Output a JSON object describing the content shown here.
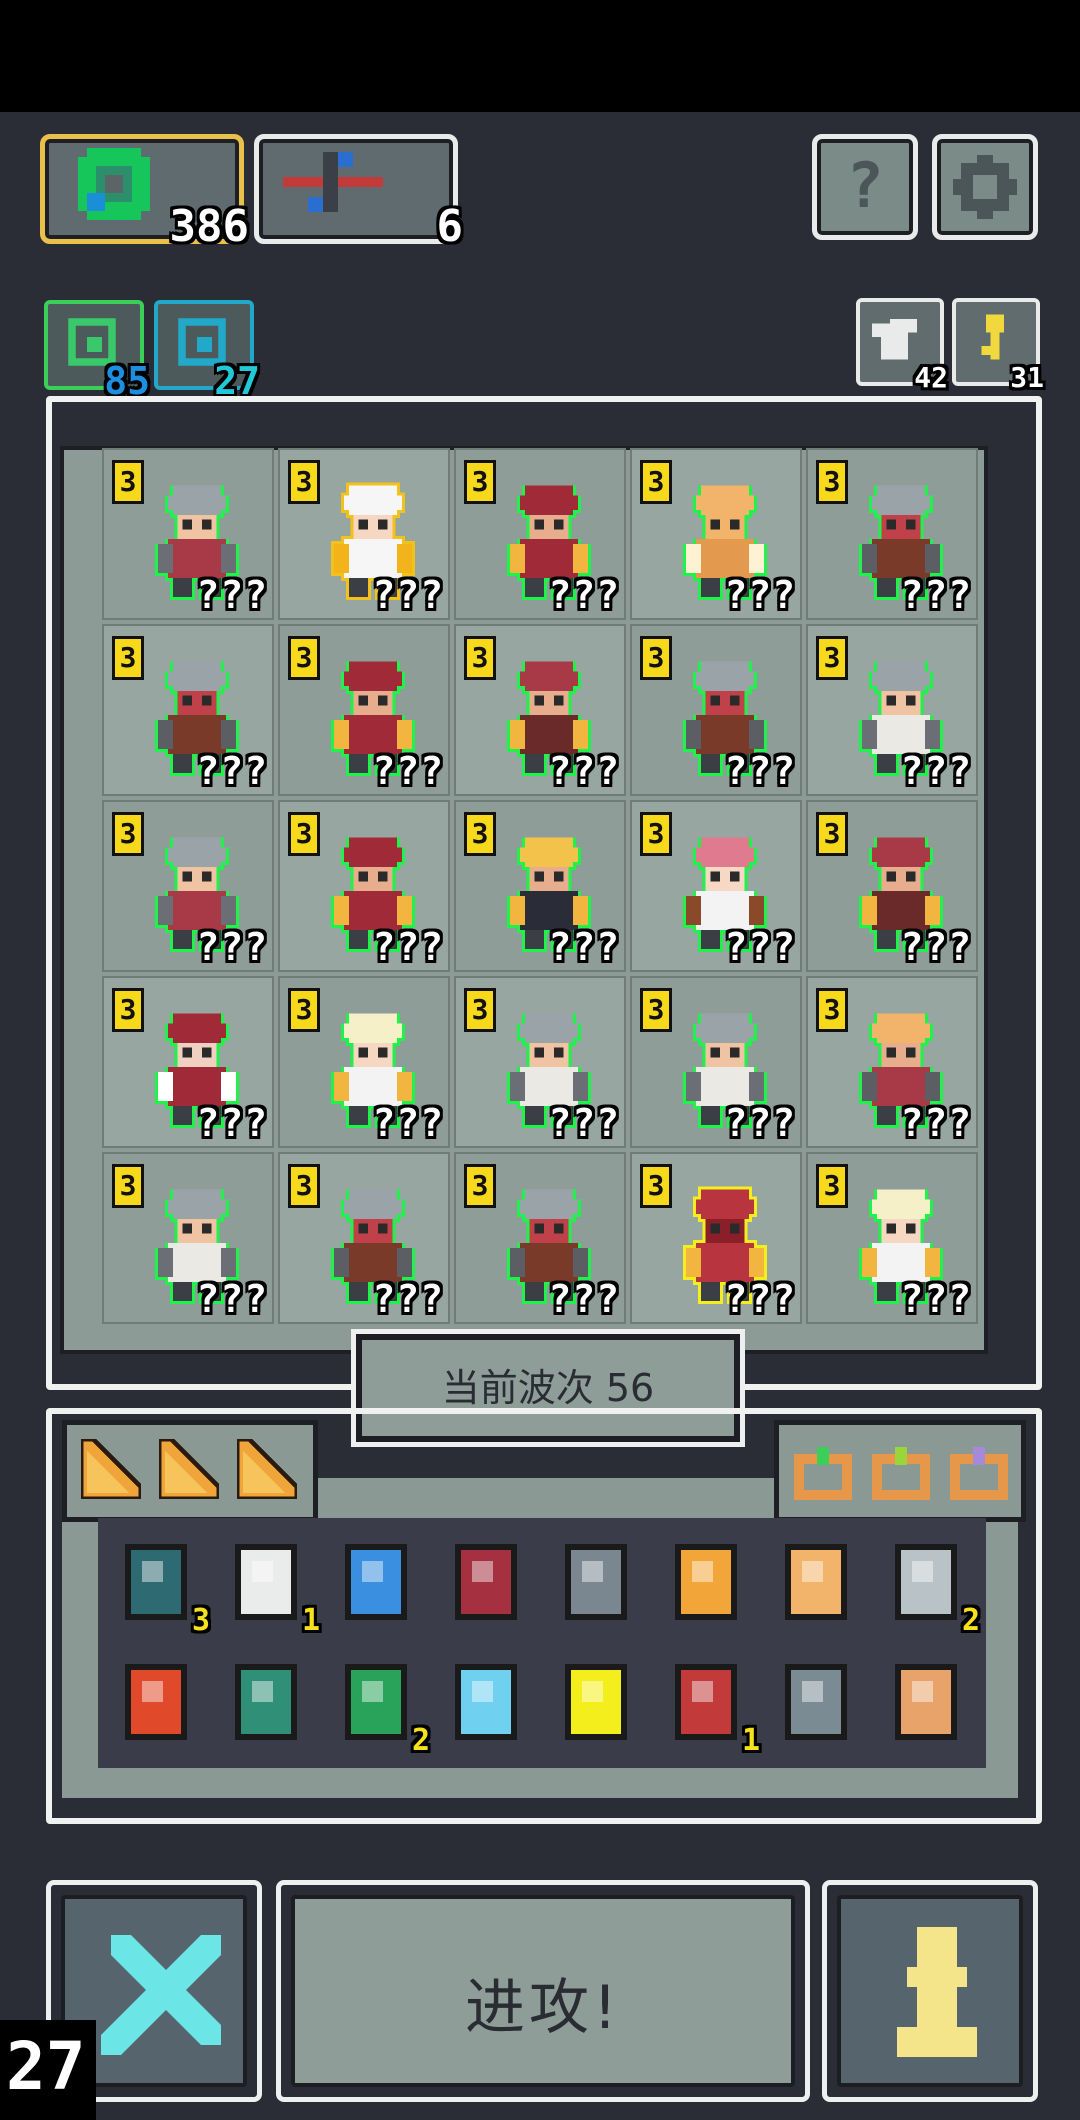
{
  "resources": {
    "main": [
      {
        "icon": "green-gem-icon",
        "value": "386",
        "active": true
      },
      {
        "icon": "crossbow-icon",
        "value": "6",
        "active": false
      }
    ],
    "small": [
      {
        "icon": "green-spiral-icon",
        "value": "85",
        "color": "#1d8fe0"
      },
      {
        "icon": "blue-spiral-icon",
        "value": "27",
        "color": "#22c8d8"
      }
    ],
    "right_small": [
      {
        "icon": "return-arrow-icon",
        "value": "42"
      },
      {
        "icon": "key-icon",
        "value": "31"
      }
    ],
    "help_label": "?",
    "settings_icon": "gear-icon"
  },
  "board": {
    "units": [
      {
        "level": "3",
        "label": "???",
        "type": "knight",
        "outline": "green"
      },
      {
        "level": "3",
        "label": "???",
        "type": "angel",
        "outline": "gold"
      },
      {
        "level": "3",
        "label": "???",
        "type": "chief",
        "outline": "green"
      },
      {
        "level": "3",
        "label": "???",
        "type": "golem",
        "outline": "green"
      },
      {
        "level": "3",
        "label": "???",
        "type": "shield-knight",
        "outline": "green"
      },
      {
        "level": "3",
        "label": "???",
        "type": "shield-knight",
        "outline": "green"
      },
      {
        "level": "3",
        "label": "???",
        "type": "chief",
        "outline": "green"
      },
      {
        "level": "3",
        "label": "???",
        "type": "brawler",
        "outline": "green"
      },
      {
        "level": "3",
        "label": "???",
        "type": "shield-knight",
        "outline": "green"
      },
      {
        "level": "3",
        "label": "???",
        "type": "knight-armored",
        "outline": "green"
      },
      {
        "level": "3",
        "label": "???",
        "type": "knight",
        "outline": "green"
      },
      {
        "level": "3",
        "label": "???",
        "type": "chief",
        "outline": "green"
      },
      {
        "level": "3",
        "label": "???",
        "type": "monk",
        "outline": "green"
      },
      {
        "level": "3",
        "label": "???",
        "type": "archer-girl",
        "outline": "green"
      },
      {
        "level": "3",
        "label": "???",
        "type": "brawler",
        "outline": "green"
      },
      {
        "level": "3",
        "label": "???",
        "type": "mage",
        "outline": "green"
      },
      {
        "level": "3",
        "label": "???",
        "type": "king",
        "outline": "green"
      },
      {
        "level": "3",
        "label": "???",
        "type": "knight-armored",
        "outline": "green"
      },
      {
        "level": "3",
        "label": "???",
        "type": "knight-armored",
        "outline": "green"
      },
      {
        "level": "3",
        "label": "???",
        "type": "golem-dark",
        "outline": "green"
      },
      {
        "level": "3",
        "label": "???",
        "type": "knight-armored",
        "outline": "green"
      },
      {
        "level": "3",
        "label": "???",
        "type": "shield-knight",
        "outline": "green"
      },
      {
        "level": "3",
        "label": "???",
        "type": "shield-knight",
        "outline": "green"
      },
      {
        "level": "3",
        "label": "???",
        "type": "red-knight",
        "outline": "yellow"
      },
      {
        "level": "3",
        "label": "???",
        "type": "king",
        "outline": "green"
      }
    ]
  },
  "wave_label": "当前波次 56",
  "inventory": {
    "tabs_left": [
      "wedge-icon",
      "wedge-icon",
      "wedge-icon"
    ],
    "tabs_right": [
      "ring-green-gem-icon",
      "ring-lime-icon",
      "ring-purple-icon"
    ],
    "row1": [
      {
        "icon": "teal-heart-icon",
        "count": "3"
      },
      {
        "icon": "scroll-icon",
        "count": "1"
      },
      {
        "icon": "blue-potion-icon",
        "count": ""
      },
      {
        "icon": "red-shield-icon",
        "count": ""
      },
      {
        "icon": "horned-helmet-icon",
        "count": ""
      },
      {
        "icon": "fox-lightning-icon",
        "count": ""
      },
      {
        "icon": "bell-icon",
        "count": ""
      },
      {
        "icon": "silver-chip-icon",
        "count": "2"
      }
    ],
    "row2": [
      {
        "icon": "red-gem-icon",
        "count": ""
      },
      {
        "icon": "green-gauntlet-icon",
        "count": ""
      },
      {
        "icon": "green-flask-icon",
        "count": "2"
      },
      {
        "icon": "blue-fish-icon",
        "count": ""
      },
      {
        "icon": "yellow-flask-icon",
        "count": ""
      },
      {
        "icon": "crossbow-icon",
        "count": "1"
      },
      {
        "icon": "gray-heart-icon",
        "count": ""
      },
      {
        "icon": "tombstone-icon",
        "count": ""
      }
    ]
  },
  "buttons": {
    "close_icon": "close-icon",
    "attack_label": "进攻!",
    "pawn_icon": "pawn-icon"
  },
  "corner_counter": "27",
  "colors": {
    "background": "#2b2d36",
    "panel": "#8e9d98",
    "green_outline": "#1ff34a",
    "gold": "#f3c21a",
    "level_badge": "#f7d81a"
  }
}
